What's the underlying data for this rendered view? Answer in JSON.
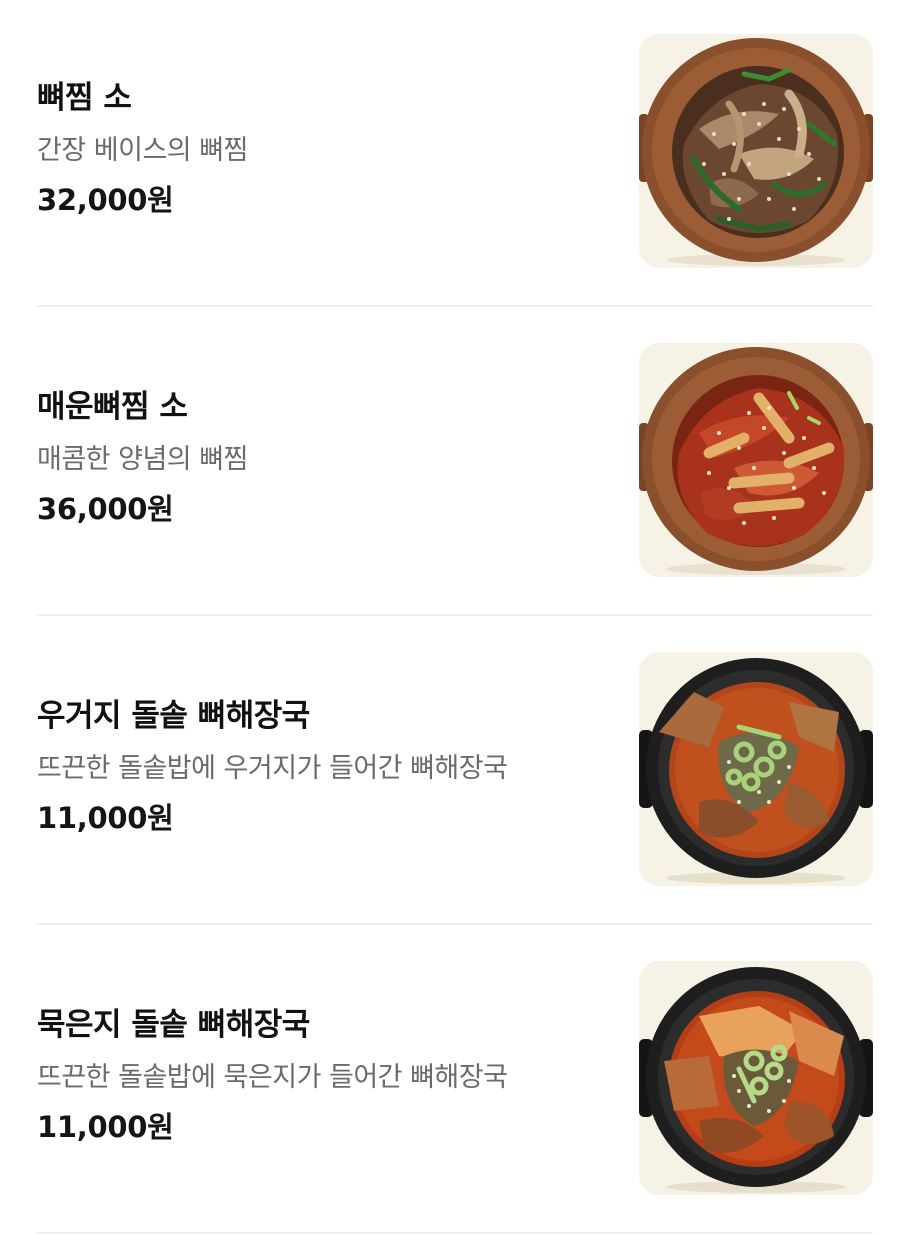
{
  "menu": {
    "items": [
      {
        "name": "뼈찜 소",
        "description": "간장 베이스의 뼈찜",
        "price": "32,000원",
        "image_icon": "braised-pork-bone-soy-icon"
      },
      {
        "name": "매운뼈찜 소",
        "description": "매콤한 양념의 뼈찜",
        "price": "36,000원",
        "image_icon": "spicy-braised-pork-bone-icon"
      },
      {
        "name": "우거지 돌솥 뼈해장국",
        "description": "뜨끈한 돌솥밥에 우거지가 들어간 뼈해장국",
        "price": "11,000원",
        "image_icon": "cabbage-bone-soup-icon"
      },
      {
        "name": "묵은지 돌솥 뼈해장국",
        "description": "뜨끈한 돌솥밥에 묵은지가 들어간 뼈해장국",
        "price": "11,000원",
        "image_icon": "kimchi-bone-soup-icon"
      }
    ]
  },
  "colors": {
    "thumb_background": "#f6f2e6",
    "clay_pot": "#8a4f2c",
    "stone_pot": "#1e1e1e",
    "soy_braise": "#5a3b26",
    "spicy_sauce": "#b8371c",
    "soup_broth": "#c0501e"
  }
}
